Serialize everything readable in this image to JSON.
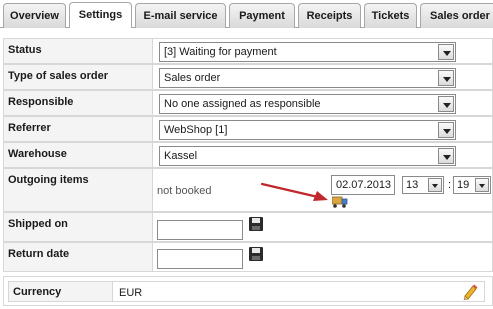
{
  "tabs": [
    {
      "label": "Overview",
      "active": false
    },
    {
      "label": "Settings",
      "active": true
    },
    {
      "label": "E-mail service",
      "active": false
    },
    {
      "label": "Payment",
      "active": false
    },
    {
      "label": "Receipts",
      "active": false
    },
    {
      "label": "Tickets",
      "active": false
    },
    {
      "label": "Sales order",
      "active": false
    }
  ],
  "fields": {
    "status": {
      "label": "Status",
      "value": "[3] Waiting for payment"
    },
    "order_type": {
      "label": "Type of sales order",
      "value": "Sales order"
    },
    "responsible": {
      "label": "Responsible",
      "value": "No one assigned as responsible"
    },
    "referrer": {
      "label": "Referrer",
      "value": "WebShop [1]"
    },
    "warehouse": {
      "label": "Warehouse",
      "value": "Kassel"
    },
    "outgoing": {
      "label": "Outgoing items",
      "status": "not booked",
      "date": "02.07.2013",
      "hour": "13",
      "separator": ":",
      "minute": "19"
    },
    "shipped_on": {
      "label": "Shipped on",
      "value": ""
    },
    "return_date": {
      "label": "Return date",
      "value": ""
    },
    "currency": {
      "label": "Currency",
      "value": "EUR"
    }
  },
  "colors": {
    "annotation_arrow": "#c0282d",
    "tab_border": "#a7a7a7",
    "label_bg": "#f4f4f4"
  },
  "icons": {
    "book_shipment": "truck-icon",
    "save": "floppy-disk-icon",
    "edit": "pencil-icon"
  }
}
